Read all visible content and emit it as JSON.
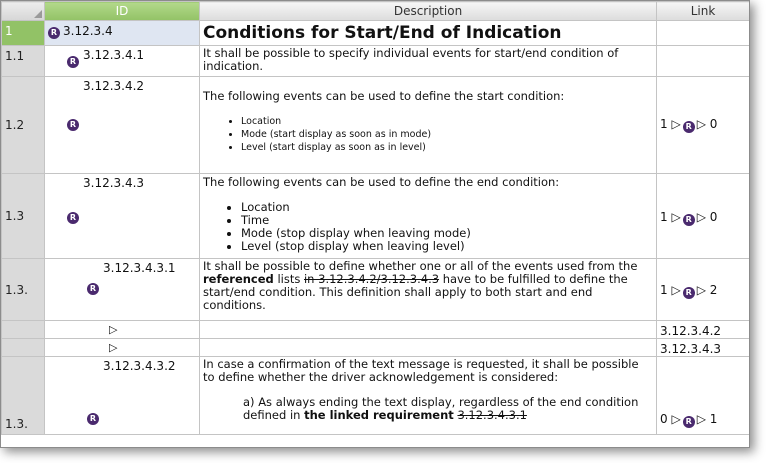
{
  "columns": {
    "id": "ID",
    "description": "Description",
    "link": "Link"
  },
  "rows": [
    {
      "row_num": "1",
      "id": "3.12.3.4",
      "description": "Conditions for Start/End of Indication"
    },
    {
      "row_num": "1.1",
      "id": "3.12.3.4.1",
      "description": "It shall be possible to specify individual events for start/end condition of indication."
    },
    {
      "row_num": "1.2",
      "id": "3.12.3.4.2",
      "intro": "The following events can be used to define the start condition:",
      "bullets": [
        "Location",
        "Mode (start display as soon as in mode)",
        "Level (start display as soon as in level)"
      ],
      "link": {
        "left": "1",
        "right": "0"
      }
    },
    {
      "row_num": "1.3",
      "id": "3.12.3.4.3",
      "intro": "The following events can be used to define the end condition:",
      "bullets": [
        "Location",
        "Time",
        "Mode (stop display when leaving mode)",
        "Level (stop display when leaving level)"
      ],
      "link": {
        "left": "1",
        "right": "0"
      }
    },
    {
      "row_num": "1.3.",
      "id": "3.12.3.4.3.1",
      "text_a": "It shall be possible to define whether one or all of the events used from the",
      "text_bold": "referenced",
      "text_b": "lists",
      "text_strike": "in 3.12.3.4.2/3.12.3.4.3",
      "text_c": "have to be fulfilled to define the start/end condition. This definition shall apply to both start and end conditions.",
      "link": {
        "left": "1",
        "right": "2"
      }
    },
    {
      "link_ref": "3.12.3.4.2"
    },
    {
      "link_ref": "3.12.3.4.3"
    },
    {
      "row_num": "1.3.",
      "id": "3.12.3.4.3.2",
      "intro": "In case a confirmation of the text message is requested, it shall be possible to define whether the driver acknowledgement is considered:",
      "item_a": "a) As always ending the text display, regardless of the end condition defined in",
      "item_bold": "the linked requirement",
      "item_strike": "3.12.3.4.3.1",
      "link": {
        "left": "0",
        "right": "1"
      }
    }
  ],
  "icons": {
    "requirement_badge": "R",
    "link_arrow": "▷"
  }
}
